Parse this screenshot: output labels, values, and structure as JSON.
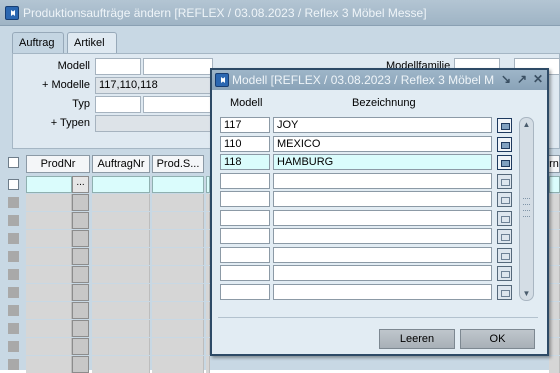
{
  "window": {
    "title": "Produktionsaufträge ändern   [REFLEX / 03.08.2023 / Reflex 3 Möbel Messe]"
  },
  "tabs": [
    {
      "label": "Auftrag"
    },
    {
      "label": "Artikel"
    }
  ],
  "form": {
    "modell_label": "Modell",
    "modelle_label": "+ Modelle",
    "modelle_value": "117,110,118",
    "typ_label": "Typ",
    "typen_label": "+ Typen",
    "modellfamilie_label": "Modellfamilie"
  },
  "grid": {
    "columns": [
      "ProdNr",
      "AuftragNr",
      "Prod.S...",
      "",
      "",
      "ern"
    ],
    "ellipsis": "..."
  },
  "dialog": {
    "title": "Modell   [REFLEX / 03.08.2023 / Reflex 3 Möbel M",
    "col_modell": "Modell",
    "col_bezeichnung": "Bezeichnung",
    "rows": [
      {
        "modell": "117",
        "bezeichnung": "JOY"
      },
      {
        "modell": "110",
        "bezeichnung": "MEXICO"
      },
      {
        "modell": "118",
        "bezeichnung": "HAMBURG"
      },
      {
        "modell": "",
        "bezeichnung": ""
      },
      {
        "modell": "",
        "bezeichnung": ""
      },
      {
        "modell": "",
        "bezeichnung": ""
      },
      {
        "modell": "",
        "bezeichnung": ""
      },
      {
        "modell": "",
        "bezeichnung": ""
      },
      {
        "modell": "",
        "bezeichnung": ""
      },
      {
        "modell": "",
        "bezeichnung": ""
      }
    ],
    "leeren_label": "Leeren",
    "ok_label": "OK"
  }
}
